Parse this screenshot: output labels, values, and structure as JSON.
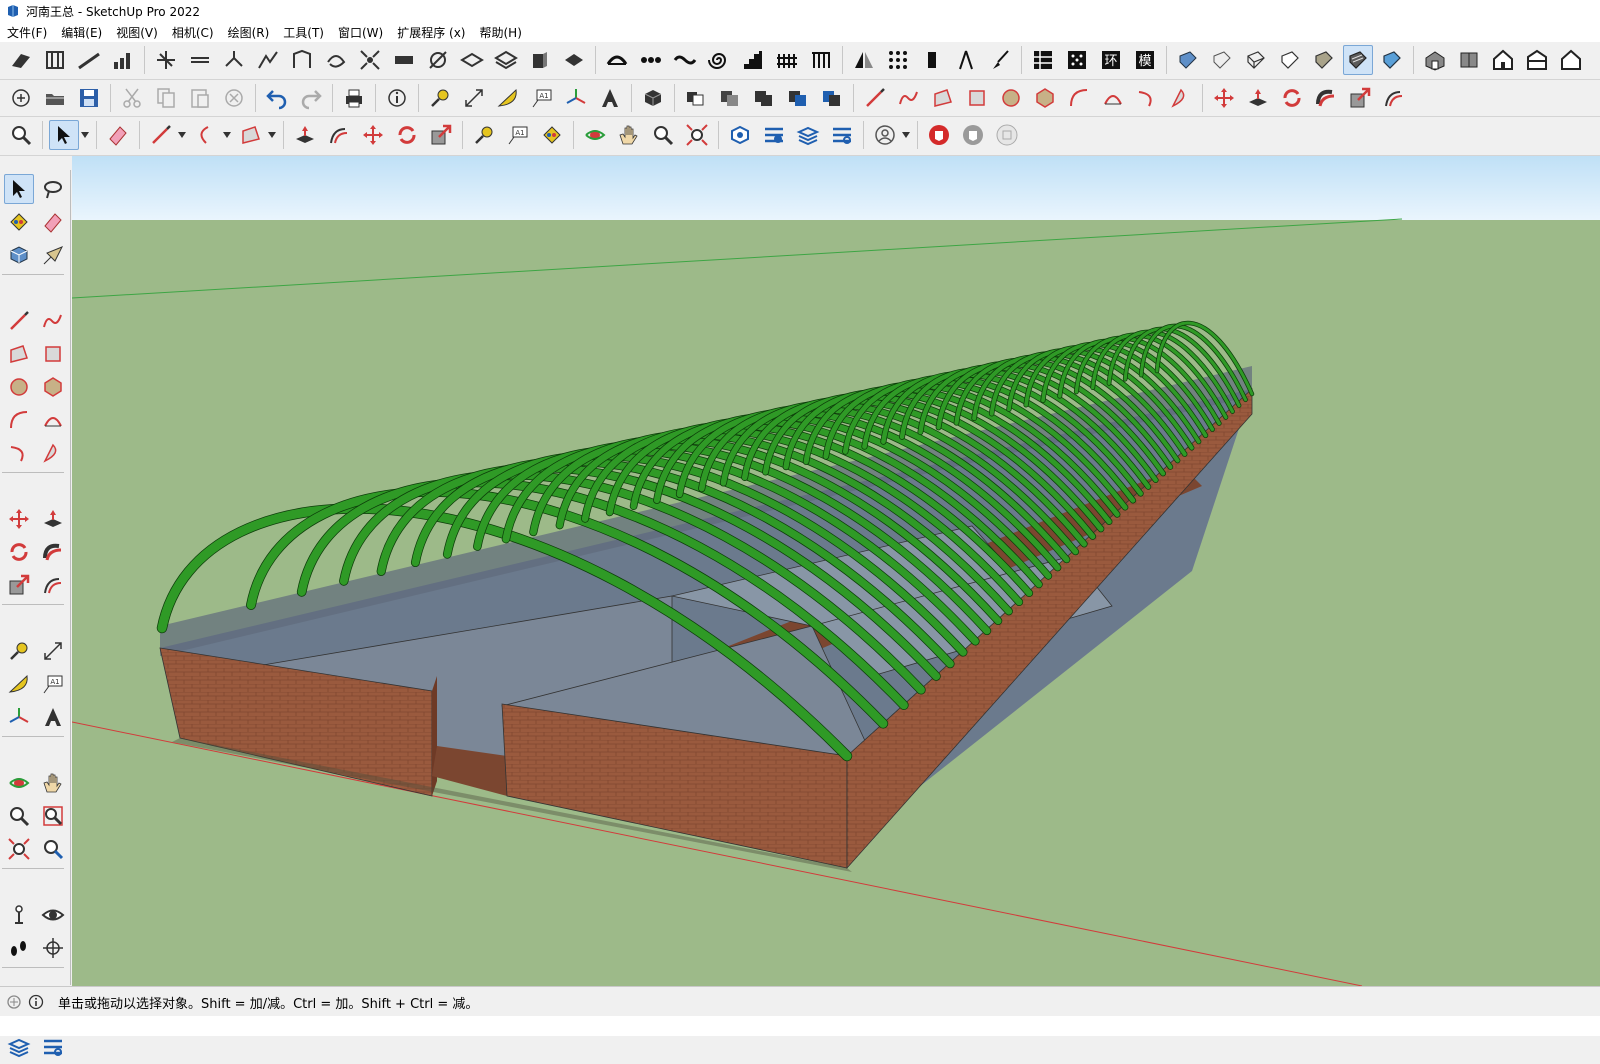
{
  "window": {
    "title": "河南王总 - SketchUp Pro 2022"
  },
  "menu": [
    "文件(F)",
    "编辑(E)",
    "视图(V)",
    "相机(C)",
    "绘图(R)",
    "工具(T)",
    "窗口(W)",
    "扩展程序 (x)",
    "帮助(H)"
  ],
  "status": {
    "hint": "单击或拖动以选择对象。Shift = 加/减。Ctrl = 加。Shift + Ctrl = 减。"
  },
  "colors": {
    "sky_top": "#bfe0f6",
    "sky_bottom": "#eaf5fd",
    "ground": "#9dba89",
    "arch_green": "#2f9a26",
    "brick": "#9a5a3e",
    "glass": "#7b8797",
    "axis_red": "#d23b3b",
    "axis_green": "#3da544"
  }
}
